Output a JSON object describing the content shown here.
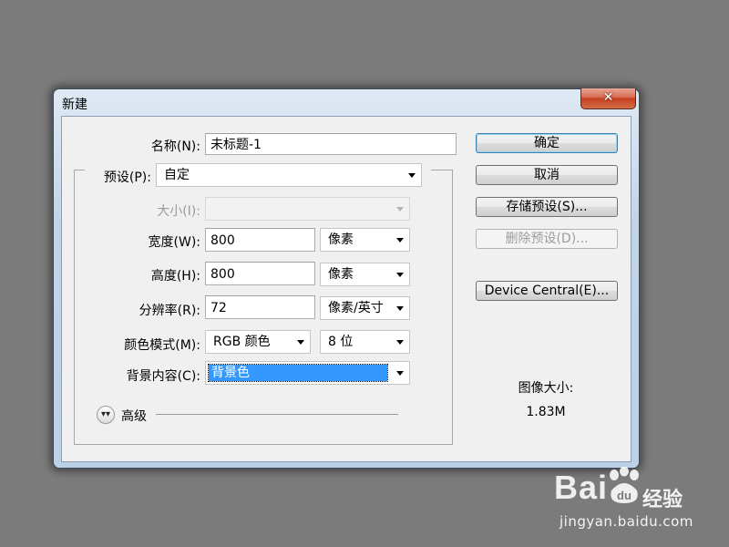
{
  "dialog": {
    "title": "新建",
    "close_glyph": "✕"
  },
  "form": {
    "name": {
      "label": "名称(N):",
      "value": "未标题-1"
    },
    "preset": {
      "label": "预设(P):",
      "value": "自定"
    },
    "size": {
      "label": "大小(I):",
      "value": ""
    },
    "width": {
      "label": "宽度(W):",
      "value": "800",
      "unit": "像素"
    },
    "height": {
      "label": "高度(H):",
      "value": "800",
      "unit": "像素"
    },
    "resolution": {
      "label": "分辨率(R):",
      "value": "72",
      "unit": "像素/英寸"
    },
    "color_mode": {
      "label": "颜色模式(M):",
      "mode": "RGB 颜色",
      "depth": "8 位"
    },
    "background": {
      "label": "背景内容(C):",
      "value": "背景色"
    },
    "advanced": {
      "label": "高级",
      "icon": "chevron-double-down-icon"
    }
  },
  "buttons": {
    "ok": "确定",
    "cancel": "取消",
    "save_preset": "存储预设(S)...",
    "delete_preset": "删除预设(D)...",
    "device_central": "Device Central(E)..."
  },
  "image_size": {
    "label": "图像大小:",
    "value": "1.83M"
  },
  "watermark": {
    "logo_prefix": "Bai",
    "logo_suffix": "经验",
    "paw_text": "du",
    "url": "jingyan.baidu.com"
  },
  "colors": {
    "desktop": "#7b7b7b",
    "selection": "#3399ff",
    "close_button": "#c4401f"
  }
}
